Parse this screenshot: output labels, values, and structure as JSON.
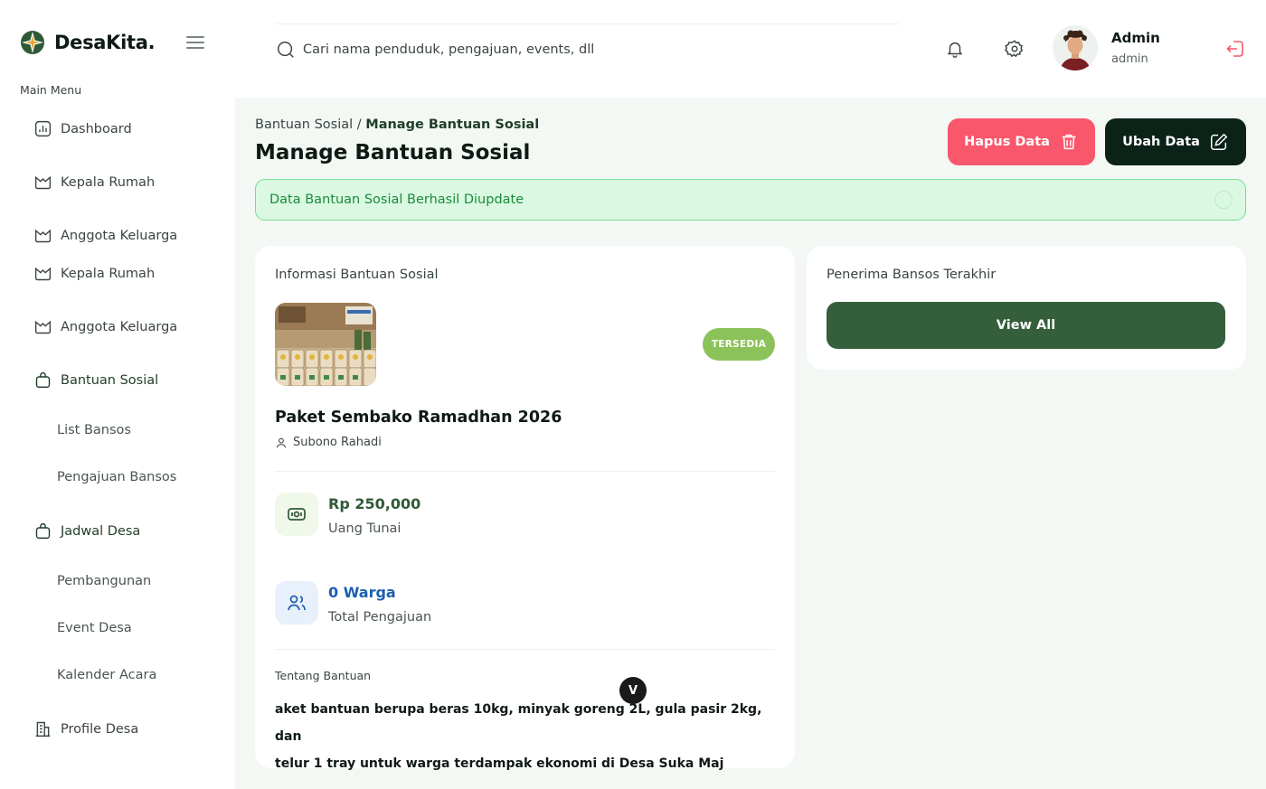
{
  "brand": {
    "name": "DesaKita."
  },
  "sidebar": {
    "menu_title": "Main Menu",
    "items": [
      {
        "label": "Dashboard"
      },
      {
        "label": "Kepala Rumah"
      },
      {
        "label": "Anggota Keluarga"
      },
      {
        "label": "Kepala Rumah"
      },
      {
        "label": "Anggota Keluarga"
      },
      {
        "label": "Bantuan Sosial"
      },
      {
        "label": "List Bansos"
      },
      {
        "label": "Pengajuan Bansos"
      },
      {
        "label": "Jadwal Desa"
      },
      {
        "label": "Pembangunan"
      },
      {
        "label": "Event Desa"
      },
      {
        "label": "Kalender Acara"
      },
      {
        "label": "Profile Desa"
      }
    ]
  },
  "search": {
    "placeholder": "Cari nama penduduk, pengajuan, events, dll"
  },
  "user": {
    "name": "Admin",
    "role": "admin"
  },
  "page": {
    "breadcrumb_parent": "Bantuan Sosial",
    "breadcrumb_sep": " / ",
    "breadcrumb_current": "Manage Bantuan Sosial",
    "title": "Manage Bantuan Sosial",
    "delete_label": "Hapus Data",
    "edit_label": "Ubah Data",
    "alert_text": "Data Bantuan Sosial Berhasil Diupdate"
  },
  "info_card": {
    "title": "Informasi Bantuan Sosial",
    "status": "TERSEDIA",
    "aid_name": "Paket Sembako Ramadhan 2026",
    "author": "Subono Rahadi",
    "amount": "Rp 250,000",
    "amount_label": "Uang Tunai",
    "applicants": "0 Warga",
    "applicants_label": "Total Pengajuan",
    "about_title": "Tentang Bantuan",
    "about_line1": "aket bantuan berupa beras 10kg, minyak goreng 2L, gula pasir 2kg, dan",
    "about_line2": "telur 1 tray untuk warga terdampak ekonomi di Desa Suka Maj",
    "scroll_glyph": "V"
  },
  "recipients_card": {
    "title": "Penerima Bansos Terakhir",
    "view_all_label": "View All"
  },
  "colors": {
    "primary_dark": "#0b2218",
    "primary_green": "#355e3b",
    "danger": "#f9576c",
    "success_bg": "#dbf9e2",
    "badge_green": "#8cc25a",
    "link_blue": "#1d5fb0"
  }
}
